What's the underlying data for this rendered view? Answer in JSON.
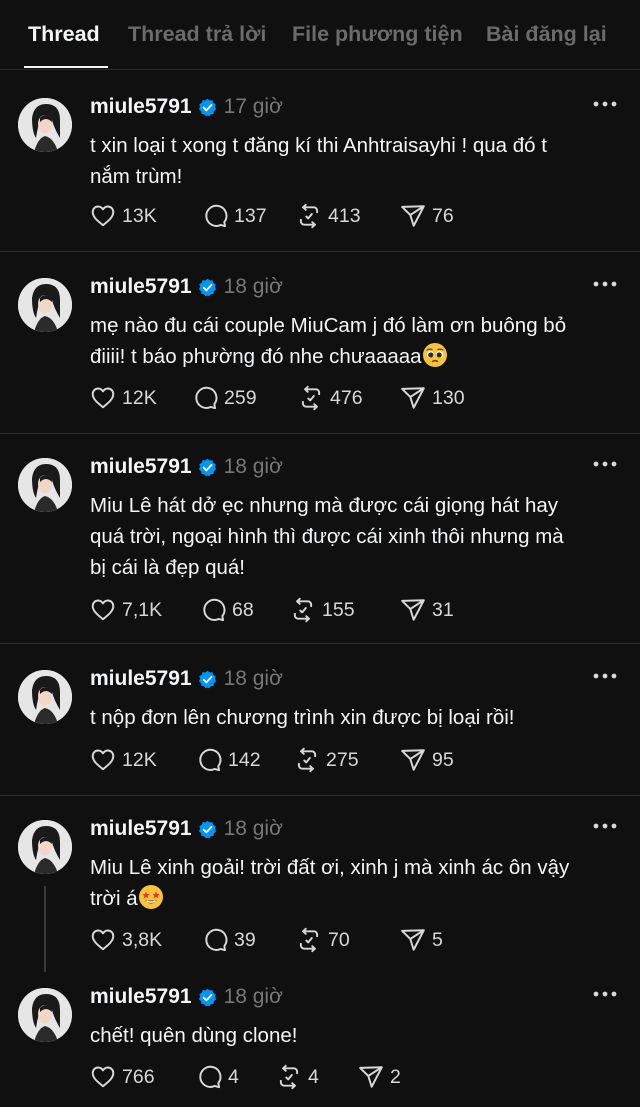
{
  "tabs": [
    {
      "label": "Thread"
    },
    {
      "label": "Thread trả lời"
    },
    {
      "label": "File phương tiện"
    },
    {
      "label": "Bài đăng lại"
    }
  ],
  "colors": {
    "background": "#101010",
    "verified": "#0095f6",
    "muted": "#777777"
  },
  "posts": [
    {
      "username": "miule5791",
      "time": "17 giờ",
      "text_lines": [
        "t xin loại t xong t đăng kí thi Anhtraisayhi ! qua đó t",
        "nắm trùm!"
      ],
      "likes": "13K",
      "replies": "137",
      "reposts": "413",
      "shares": "76"
    },
    {
      "username": "miule5791",
      "time": "18 giờ",
      "text_lines": [
        "mẹ nào đu cái couple MiuCam j đó làm ơn buông bỏ",
        "điiii! t báo phường đó nhe chưaaaaa"
      ],
      "likes": "12K",
      "replies": "259",
      "reposts": "476",
      "shares": "130"
    },
    {
      "username": "miule5791",
      "time": "18 giờ",
      "text_lines": [
        "Miu Lê hát dở ẹc nhưng mà được cái giọng hát hay",
        "quá trời, ngoại hình thì được cái xinh thôi nhưng mà",
        "bị cái là đẹp quá!"
      ],
      "likes": "7,1K",
      "replies": "68",
      "reposts": "155",
      "shares": "31"
    },
    {
      "username": "miule5791",
      "time": "18 giờ",
      "text_lines": [
        "t nộp đơn lên chương trình xin được bị loại rồi!"
      ],
      "likes": "12K",
      "replies": "142",
      "reposts": "275",
      "shares": "95"
    },
    {
      "username": "miule5791",
      "time": "18 giờ",
      "text_lines": [
        "Miu Lê xinh goải! trời đất ơi, xinh j mà xinh ác ôn vậy",
        "trời á"
      ],
      "likes": "3,8K",
      "replies": "39",
      "reposts": "70",
      "shares": "5"
    },
    {
      "username": "miule5791",
      "time": "18 giờ",
      "text_lines": [
        "chết! quên dùng clone!"
      ],
      "likes": "766",
      "replies": "4",
      "reposts": "4",
      "shares": "2"
    }
  ]
}
